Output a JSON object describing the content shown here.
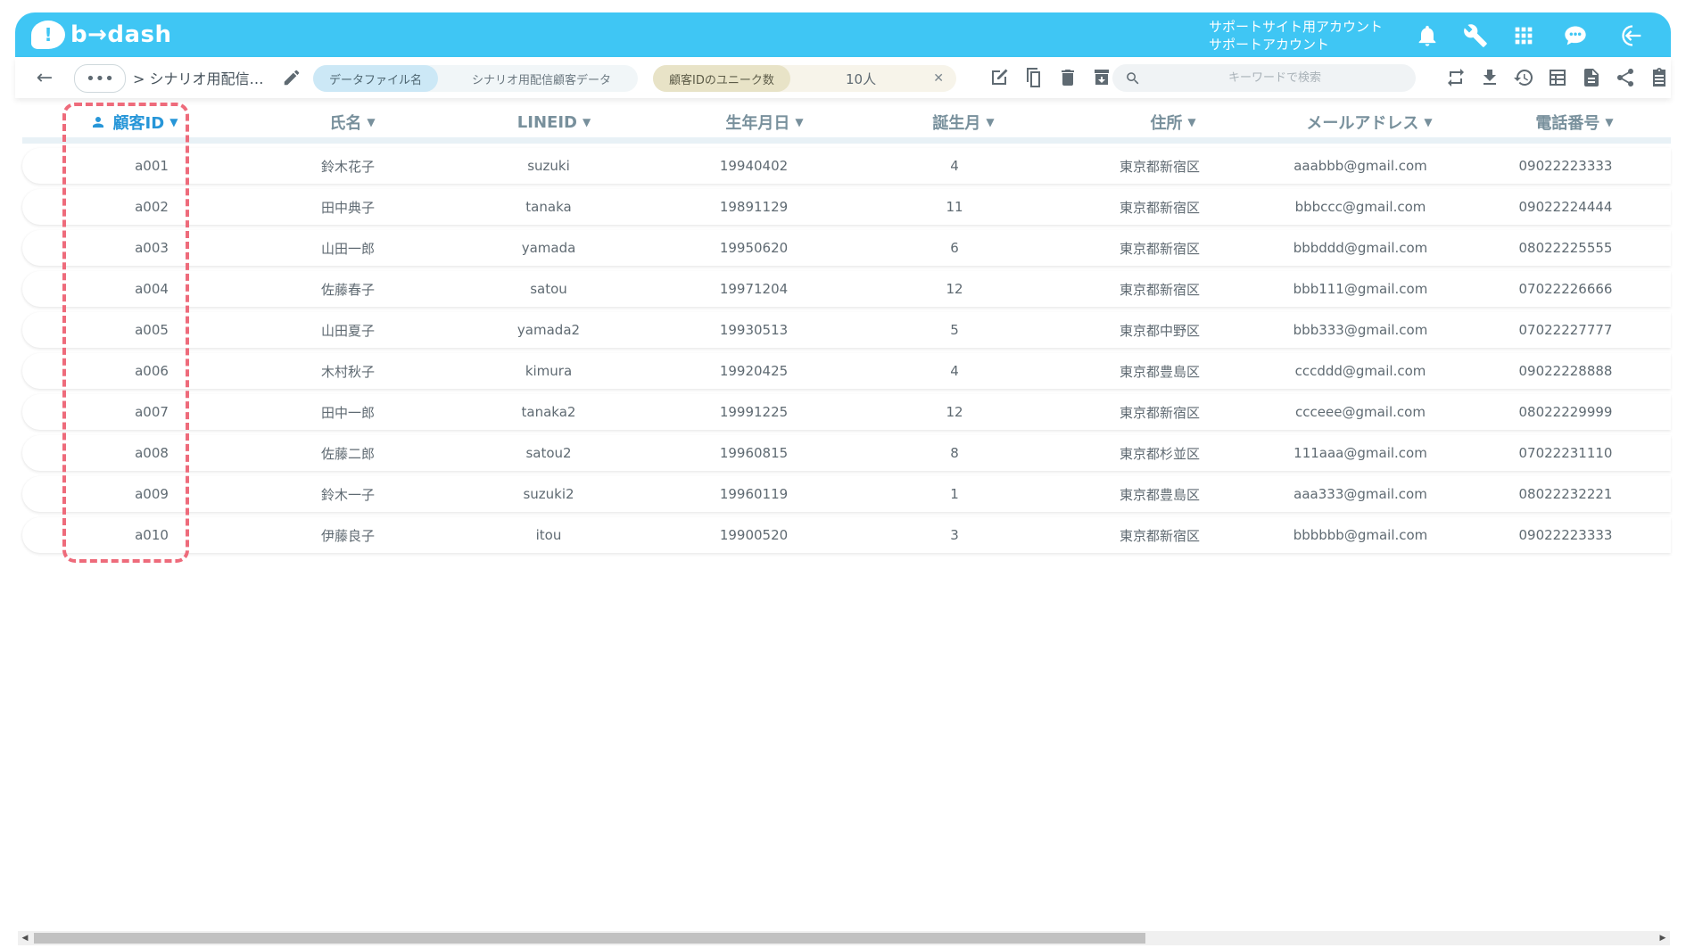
{
  "header": {
    "logo_text": "b→dash",
    "account_line1": "サポートサイト用アカウント",
    "account_line2": "サポートアカウント",
    "icons": [
      "bell-icon",
      "wrench-icon",
      "grid-icon",
      "chat-icon",
      "logout-icon"
    ]
  },
  "toolbar": {
    "more_label": "•••",
    "breadcrumb": "> シナリオ用配信…",
    "file_label": "データファイル名",
    "file_value": "シナリオ用配信顧客データ",
    "unique_label": "顧客IDのユニーク数",
    "unique_value": "10人",
    "search_placeholder": "キーワードで検索",
    "icons": [
      "edit-icon",
      "copy-icon",
      "trash-icon",
      "archive-icon",
      "sync-icon",
      "download-icon",
      "history-icon",
      "table-view-icon",
      "document-icon",
      "share-icon",
      "clipboard-icon"
    ]
  },
  "table": {
    "columns": [
      "顧客ID",
      "氏名",
      "LINEID",
      "生年月日",
      "誕生月",
      "住所",
      "メールアドレス",
      "電話番号"
    ],
    "rows": [
      [
        "a001",
        "鈴木花子",
        "suzuki",
        "19940402",
        "4",
        "東京都新宿区",
        "aaabbb@gmail.com",
        "09022223333"
      ],
      [
        "a002",
        "田中典子",
        "tanaka",
        "19891129",
        "11",
        "東京都新宿区",
        "bbbccc@gmail.com",
        "09022224444"
      ],
      [
        "a003",
        "山田一郎",
        "yamada",
        "19950620",
        "6",
        "東京都新宿区",
        "bbbddd@gmail.com",
        "08022225555"
      ],
      [
        "a004",
        "佐藤春子",
        "satou",
        "19971204",
        "12",
        "東京都新宿区",
        "bbb111@gmail.com",
        "07022226666"
      ],
      [
        "a005",
        "山田夏子",
        "yamada2",
        "19930513",
        "5",
        "東京都中野区",
        "bbb333@gmail.com",
        "07022227777"
      ],
      [
        "a006",
        "木村秋子",
        "kimura",
        "19920425",
        "4",
        "東京都豊島区",
        "cccddd@gmail.com",
        "09022228888"
      ],
      [
        "a007",
        "田中一郎",
        "tanaka2",
        "19991225",
        "12",
        "東京都新宿区",
        "ccceee@gmail.com",
        "08022229999"
      ],
      [
        "a008",
        "佐藤二郎",
        "satou2",
        "19960815",
        "8",
        "東京都杉並区",
        "111aaa@gmail.com",
        "07022231110"
      ],
      [
        "a009",
        "鈴木一子",
        "suzuki2",
        "19960119",
        "1",
        "東京都豊島区",
        "aaa333@gmail.com",
        "08022232221"
      ],
      [
        "a010",
        "伊藤良子",
        "itou",
        "19900520",
        "3",
        "東京都新宿区",
        "bbbbbb@gmail.com",
        "09022223333"
      ]
    ]
  },
  "colors": {
    "header_bg": "#3fc6f4",
    "key_column": "#2796d8",
    "highlight": "#ee6b7b"
  }
}
